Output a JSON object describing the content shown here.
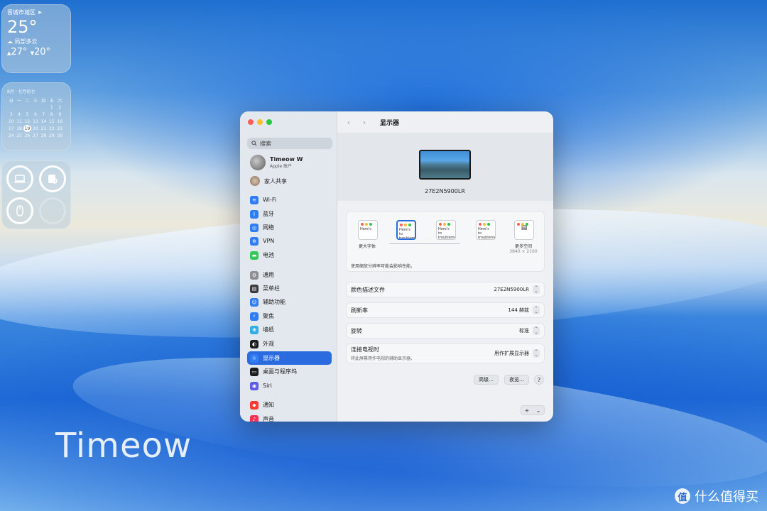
{
  "desktop": {
    "watermark": "Timeow",
    "site_logo_badge": "值",
    "site_logo_text": "什么值得买"
  },
  "weather": {
    "location": "晋城市城区",
    "temp": "25°",
    "condition": "局部多云",
    "high": "27°",
    "low": "20°"
  },
  "calendar": {
    "header": "8月 · 七月初七",
    "weekdays": [
      "日",
      "一",
      "二",
      "三",
      "四",
      "五",
      "六"
    ],
    "rows": [
      [
        "",
        "",
        "",
        "",
        "",
        "1",
        "2"
      ],
      [
        "3",
        "4",
        "5",
        "6",
        "7",
        "8",
        "9"
      ],
      [
        "10",
        "11",
        "12",
        "13",
        "14",
        "15",
        "16"
      ],
      [
        "17",
        "18",
        "19",
        "20",
        "21",
        "22",
        "23"
      ],
      [
        "24",
        "25",
        "26",
        "27",
        "28",
        "29",
        "30"
      ]
    ],
    "today": "19"
  },
  "window": {
    "title": "显示器",
    "search_placeholder": "搜索",
    "account": {
      "name": "Timeow W",
      "subtitle": "Apple 账户"
    },
    "family": "家人共享",
    "nav": [
      {
        "label": "Wi-Fi",
        "icon": "wifi-icon",
        "color": "#2f7cf6"
      },
      {
        "label": "蓝牙",
        "icon": "bluetooth-icon",
        "color": "#2f7cf6"
      },
      {
        "label": "网络",
        "icon": "globe-icon",
        "color": "#2f7cf6"
      },
      {
        "label": "VPN",
        "icon": "vpn-icon",
        "color": "#2f7cf6"
      },
      {
        "label": "电池",
        "icon": "battery-icon",
        "color": "#34c759"
      },
      {
        "label": "通用",
        "icon": "gear-icon",
        "color": "#8e8e93"
      },
      {
        "label": "菜单栏",
        "icon": "menubar-icon",
        "color": "#3a3a3c"
      },
      {
        "label": "辅助功能",
        "icon": "accessibility-icon",
        "color": "#2f7cf6"
      },
      {
        "label": "聚焦",
        "icon": "spotlight-icon",
        "color": "#2f7cf6"
      },
      {
        "label": "墙纸",
        "icon": "wallpaper-icon",
        "color": "#32ade6"
      },
      {
        "label": "外观",
        "icon": "appearance-icon",
        "color": "#1c1c1e"
      },
      {
        "label": "显示器",
        "icon": "display-icon",
        "color": "#2f7cf6"
      },
      {
        "label": "桌面与程序坞",
        "icon": "dock-icon",
        "color": "#1c1c1e"
      },
      {
        "label": "Siri",
        "icon": "siri-icon",
        "color": "#5e5ce6"
      },
      {
        "label": "通知",
        "icon": "bell-icon",
        "color": "#ff3b30"
      },
      {
        "label": "声音",
        "icon": "sound-icon",
        "color": "#ff2d55"
      }
    ],
    "active_nav": "显示器",
    "monitor_name": "27E2N5900LR",
    "resolution": {
      "options": [
        "Here's",
        "Here's to troublem",
        "Here's to troublema ones who",
        "Here's to troublemakers round ones who see rules. And the",
        ""
      ],
      "selected_index": 1,
      "left_caption": "更大字体",
      "right_caption": "更多空间",
      "right_sub": "3840 × 2160",
      "note": "使用缩放分辨率可能会影响性能。"
    },
    "rows": [
      {
        "label": "颜色描述文件",
        "value": "27E2N5900LR"
      },
      {
        "label": "刷新率",
        "value": "144 赫兹"
      },
      {
        "label": "旋转",
        "value": "标准"
      },
      {
        "label": "连接电视时",
        "sub": "将此屏幕用作电视的辅助显示器。",
        "value": "用作扩展显示器"
      }
    ],
    "buttons": {
      "advanced": "高级...",
      "night_shift": "夜览...",
      "help": "?",
      "add": "+",
      "add_menu": "⌄"
    },
    "traffic": {
      "close": "#ff5f57",
      "min": "#febc2e",
      "max": "#28c840"
    }
  }
}
